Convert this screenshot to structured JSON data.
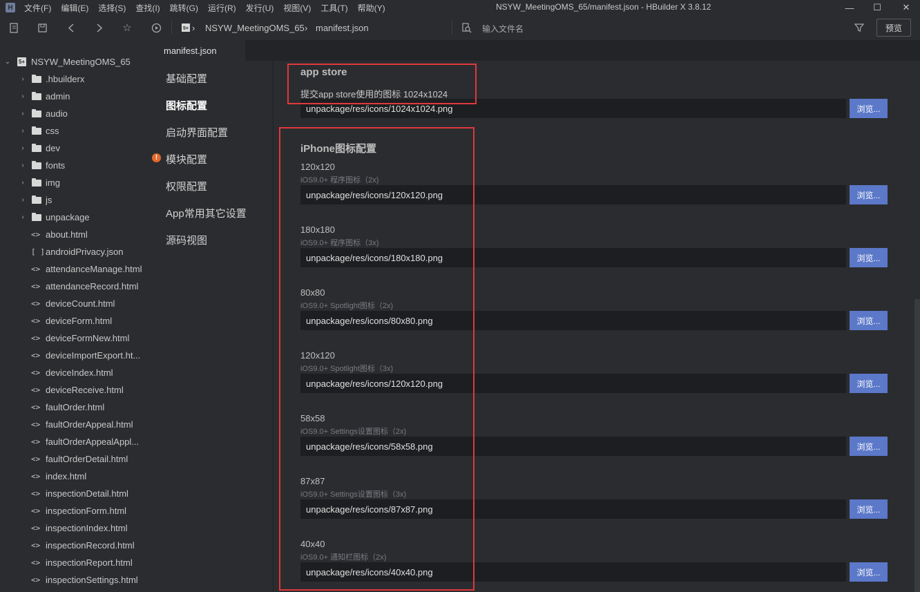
{
  "titlebar": {
    "menus": [
      "文件(F)",
      "编辑(E)",
      "选择(S)",
      "查找(I)",
      "跳转(G)",
      "运行(R)",
      "发行(U)",
      "视图(V)",
      "工具(T)",
      "帮助(Y)"
    ],
    "window_title": "NSYW_MeetingOMS_65/manifest.json - HBuilder X 3.8.12"
  },
  "toolbar": {
    "breadcrumb_project": "NSYW_MeetingOMS_65",
    "breadcrumb_file": "manifest.json",
    "file_search_placeholder": "输入文件名",
    "preview_label": "预览"
  },
  "filetree": {
    "project": "NSYW_MeetingOMS_65",
    "folders": [
      ".hbuilderx",
      "admin",
      "audio",
      "css",
      "dev",
      "fonts",
      "img",
      "js",
      "unpackage"
    ],
    "files": [
      {
        "icon": "<>",
        "name": "about.html"
      },
      {
        "icon": "[ ]",
        "name": "androidPrivacy.json"
      },
      {
        "icon": "<>",
        "name": "attendanceManage.html"
      },
      {
        "icon": "<>",
        "name": "attendanceRecord.html"
      },
      {
        "icon": "<>",
        "name": "deviceCount.html"
      },
      {
        "icon": "<>",
        "name": "deviceForm.html"
      },
      {
        "icon": "<>",
        "name": "deviceFormNew.html"
      },
      {
        "icon": "<>",
        "name": "deviceImportExport.ht..."
      },
      {
        "icon": "<>",
        "name": "deviceIndex.html"
      },
      {
        "icon": "<>",
        "name": "deviceReceive.html"
      },
      {
        "icon": "<>",
        "name": "faultOrder.html"
      },
      {
        "icon": "<>",
        "name": "faultOrderAppeal.html"
      },
      {
        "icon": "<>",
        "name": "faultOrderAppealAppl..."
      },
      {
        "icon": "<>",
        "name": "faultOrderDetail.html"
      },
      {
        "icon": "<>",
        "name": "index.html"
      },
      {
        "icon": "<>",
        "name": "inspectionDetail.html"
      },
      {
        "icon": "<>",
        "name": "inspectionForm.html"
      },
      {
        "icon": "<>",
        "name": "inspectionIndex.html"
      },
      {
        "icon": "<>",
        "name": "inspectionRecord.html"
      },
      {
        "icon": "<>",
        "name": "inspectionReport.html"
      },
      {
        "icon": "<>",
        "name": "inspectionSettings.html"
      }
    ]
  },
  "editor": {
    "tab": "manifest.json",
    "nav": [
      "基础配置",
      "图标配置",
      "启动界面配置",
      "模块配置",
      "权限配置",
      "App常用其它设置",
      "源码视图"
    ],
    "active_nav": 1,
    "warning_nav": 3,
    "appstore": {
      "title": "app store",
      "desc": "提交app store使用的图标 1024x1024",
      "path": "unpackage/res/icons/1024x1024.png",
      "browse": "浏览..."
    },
    "iphone": {
      "title": "iPhone图标配置",
      "icons": [
        {
          "size": "120x120",
          "desc": "iOS9.0+ 程序图标（2x)",
          "path": "unpackage/res/icons/120x120.png",
          "browse": "浏览..."
        },
        {
          "size": "180x180",
          "desc": "iOS9.0+ 程序图标（3x)",
          "path": "unpackage/res/icons/180x180.png",
          "browse": "浏览..."
        },
        {
          "size": "80x80",
          "desc": "iOS9.0+ Spotlight图标（2x)",
          "path": "unpackage/res/icons/80x80.png",
          "browse": "浏览..."
        },
        {
          "size": "120x120",
          "desc": "iOS9.0+ Spotlight图标（3x)",
          "path": "unpackage/res/icons/120x120.png",
          "browse": "浏览..."
        },
        {
          "size": "58x58",
          "desc": "iOS9.0+ Settings设置图标（2x)",
          "path": "unpackage/res/icons/58x58.png",
          "browse": "浏览..."
        },
        {
          "size": "87x87",
          "desc": "iOS9.0+ Settings设置图标（3x)",
          "path": "unpackage/res/icons/87x87.png",
          "browse": "浏览..."
        },
        {
          "size": "40x40",
          "desc": "iOS9.0+ 通知栏图标（2x)",
          "path": "unpackage/res/icons/40x40.png",
          "browse": "浏览..."
        }
      ]
    }
  },
  "colors": {
    "highlight": "#e0383c",
    "browse_button": "#5b78c9",
    "warning": "#e26a2c"
  }
}
